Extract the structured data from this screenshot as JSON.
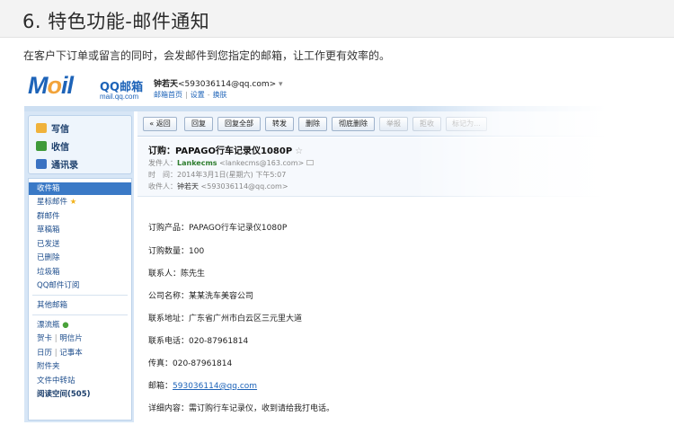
{
  "page": {
    "title": "6. 特色功能-邮件通知",
    "intro": "在客户下订单或留言的同时，会发邮件到您指定的邮箱，让工作更有效率的。"
  },
  "mail": {
    "logo": {
      "word_m": "M",
      "word_o": "o",
      "word_il": "il",
      "qq": "QQ邮箱",
      "url": "mail.qq.com"
    },
    "account": {
      "name": "钟若天",
      "email": "<593036114@qq.com>",
      "arrow": "▾"
    },
    "account_links": [
      "邮箱首页",
      "设置",
      "换肤"
    ],
    "quick": [
      {
        "label": "写信",
        "icon": "pencil-icon"
      },
      {
        "label": "收信",
        "icon": "inbox-icon"
      },
      {
        "label": "通讯录",
        "icon": "contacts-icon"
      }
    ],
    "folders": [
      {
        "label": "收件箱",
        "selected": true
      },
      {
        "label": "星标邮件",
        "suffix": "★"
      },
      {
        "label": "群邮件"
      },
      {
        "label": "草稿箱"
      },
      {
        "label": "已发送"
      },
      {
        "label": "已删除"
      },
      {
        "label": "垃圾箱"
      },
      {
        "label": "QQ邮件订阅"
      },
      {
        "label": "其他邮箱"
      },
      {
        "label": "漂流瓶",
        "suffix": "●"
      },
      {
        "label": "贺卡",
        "extra": "明信片"
      },
      {
        "label": "日历",
        "extra": "记事本"
      },
      {
        "label": "附件夹"
      },
      {
        "label": "文件中转站"
      },
      {
        "label": "阅读空间(505)",
        "bold": true
      }
    ],
    "toolbar": [
      "« 返回",
      "回复",
      "回复全部",
      "转发",
      "删除",
      "彻底删除",
      "举报",
      "拒收",
      "标记为..."
    ],
    "message": {
      "subject": "订购：PAPAGO行车记录仪1080P",
      "fav": "☆",
      "from_label": "发件人：",
      "from_name": "Lankecms",
      "from_email": "<lankecms@163.com>",
      "time_label": "时　间：",
      "time": "2014年3月1日(星期六) 下午5:07",
      "to_label": "收件人：",
      "to_name": "钟若天",
      "to_email": "<593036114@qq.com>",
      "lines": [
        "订购产品：PAPAGO行车记录仪1080P",
        "订购数量：100",
        "联系人：陈先生",
        "公司名称：某某洗车美容公司",
        "联系地址：广东省广州市白云区三元里大道",
        "联系电话：020-87961814",
        "传真：020-87961814"
      ],
      "email_label": "邮箱：",
      "email_link": "593036114@qq.com",
      "detail": "详细内容：需订购行车记录仪，收到请给我打电话。"
    }
  }
}
